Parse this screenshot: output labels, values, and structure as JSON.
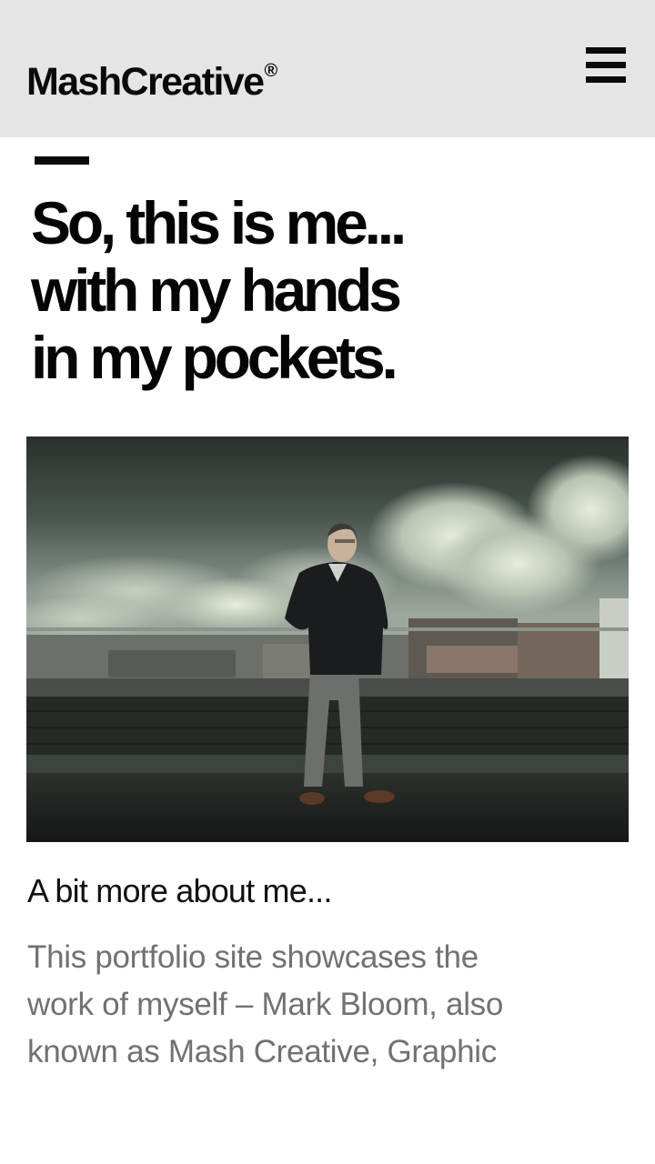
{
  "header": {
    "logo_text": "MashCreative",
    "logo_mark": "®",
    "menu_icon": "hamburger-menu-icon"
  },
  "hero": {
    "headline_lines": [
      "So, this is me...",
      "with my hands",
      "in my pockets."
    ]
  },
  "about": {
    "subheading": "A bit more about me...",
    "body_lines": [
      "This portfolio site showcases the",
      "work of myself – Mark Bloom, also",
      "known as Mash Creative, Graphic"
    ]
  },
  "colors": {
    "header_bg": "#e5e5e6",
    "text_dark": "#0a0a0a",
    "text_muted": "#717171"
  }
}
